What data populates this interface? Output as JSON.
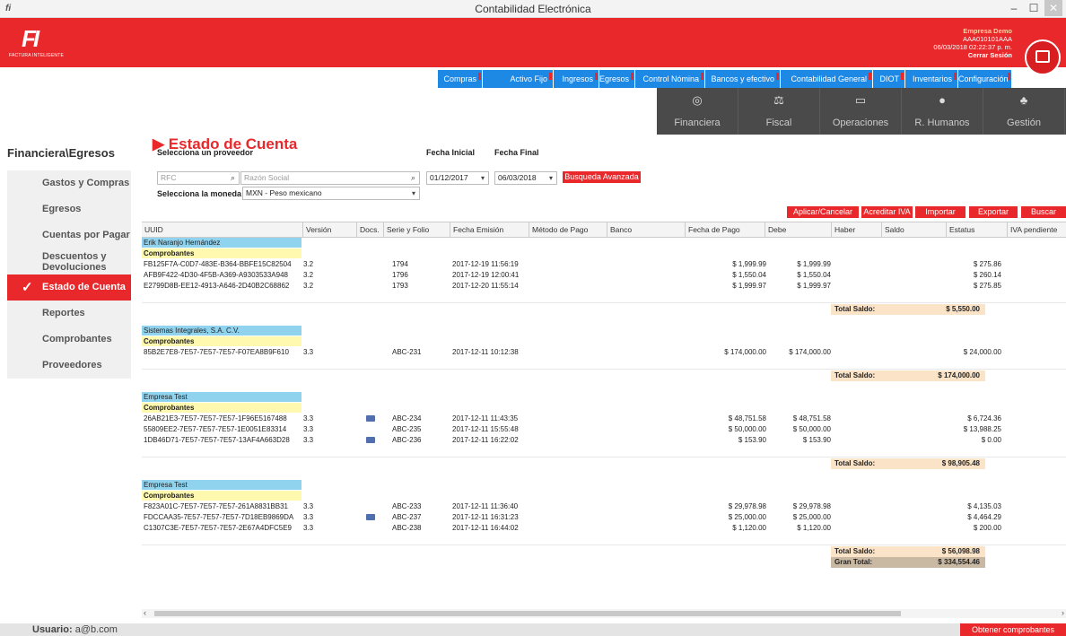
{
  "window": {
    "title": "Contabilidad Electrónica",
    "min": "–",
    "max": "☐",
    "close": "✕"
  },
  "header": {
    "logo_text": "FACTURA INTELIGENTE",
    "company_name": "Empresa Demo",
    "rfc": "AAA010101AAA",
    "datetime": "06/03/2018 02:22:37 p. m.",
    "logout": "Cerrar Sesión"
  },
  "menu": [
    "Compras",
    "Activo Fijo",
    "Ingresos",
    "Egresos",
    "Control Nómina",
    "Bancos y efectivo",
    "Contabilidad General",
    "DIOT",
    "Inventarios",
    "Configuración"
  ],
  "modules": [
    {
      "label": "Financiera",
      "icon": "coins-icon"
    },
    {
      "label": "Fiscal",
      "icon": "scale-icon"
    },
    {
      "label": "Operaciones",
      "icon": "monitor-icon"
    },
    {
      "label": "R. Humanos",
      "icon": "person-icon"
    },
    {
      "label": "Gestión",
      "icon": "org-chart-icon"
    }
  ],
  "breadcrumb": "Financiera\\Egresos",
  "sidebar": [
    {
      "label": "Gastos y Compras"
    },
    {
      "label": "Egresos"
    },
    {
      "label": "Cuentas por Pagar"
    },
    {
      "label": "Descuentos y Devoluciones"
    },
    {
      "label": "Estado de Cuenta",
      "active": true
    },
    {
      "label": "Reportes"
    },
    {
      "label": "Comprobantes"
    },
    {
      "label": "Proveedores"
    }
  ],
  "page_title": "Estado de Cuenta",
  "filters": {
    "provider_label": "Selecciona un proveedor",
    "rfc_placeholder": "RFC",
    "razon_placeholder": "Razón Social",
    "fecha_inicial_label": "Fecha Inicial",
    "fecha_inicial": "01/12/2017",
    "fecha_final_label": "Fecha Final",
    "fecha_final": "06/03/2018",
    "busqueda": "Busqueda Avanzada",
    "moneda_label": "Selecciona la moneda",
    "moneda": "MXN - Peso mexicano"
  },
  "actions": [
    "Aplicar/Cancelar",
    "Acreditar IVA",
    "Importar",
    "Exportar",
    "Buscar"
  ],
  "columns": [
    "UUID",
    "Versión",
    "Docs.",
    "Serie y Folio",
    "Fecha Emisión",
    "Método de Pago",
    "Banco",
    "Fecha de Pago",
    "Debe",
    "Haber",
    "Saldo",
    "Estatus",
    "IVA pendiente"
  ],
  "groups": [
    {
      "provider": "Erik Naranjo Hernández",
      "sub": "Comprobantes",
      "rows": [
        {
          "uuid": "FB125F7A-C0D7-483E-B364-BBFE15C82504",
          "version": "3.2",
          "doc": false,
          "folio": "1794",
          "fecha": "2017-12-19 11:56:19",
          "debe": "$ 1,999.99",
          "haber": "$ 1,999.99",
          "iva": "$ 275.86"
        },
        {
          "uuid": "AFB9F422-4D30-4F5B-A369-A9303533A948",
          "version": "3.2",
          "doc": false,
          "folio": "1796",
          "fecha": "2017-12-19 12:00:41",
          "debe": "$ 1,550.04",
          "haber": "$ 1,550.04",
          "iva": "$ 260.14"
        },
        {
          "uuid": "E2799D8B-EE12-4913-A646-2D40B2C68862",
          "version": "3.2",
          "doc": false,
          "folio": "1793",
          "fecha": "2017-12-20 11:55:14",
          "debe": "$ 1,999.97",
          "haber": "$ 1,999.97",
          "iva": "$ 275.85"
        }
      ],
      "total_label": "Total Saldo:",
      "total": "$ 5,550.00"
    },
    {
      "provider": "Sistemas Integrales, S.A. C.V.",
      "sub": "Comprobantes",
      "rows": [
        {
          "uuid": "85B2E7E8-7E57-7E57-7E57-F07EA8B9F610",
          "version": "3.3",
          "doc": false,
          "folio": "ABC-231",
          "fecha": "2017-12-11 10:12:38",
          "debe": "$ 174,000.00",
          "haber": "$ 174,000.00",
          "iva": "$ 24,000.00"
        }
      ],
      "total_label": "Total Saldo:",
      "total": "$ 174,000.00"
    },
    {
      "provider": "Empresa Test",
      "sub": "Comprobantes",
      "rows": [
        {
          "uuid": "26AB21E3-7E57-7E57-7E57-1F96E5167488",
          "version": "3.3",
          "doc": true,
          "folio": "ABC-234",
          "fecha": "2017-12-11 11:43:35",
          "debe": "$ 48,751.58",
          "haber": "$ 48,751.58",
          "iva": "$ 6,724.36"
        },
        {
          "uuid": "55809EE2-7E57-7E57-7E57-1E0051E83314",
          "version": "3.3",
          "doc": false,
          "folio": "ABC-235",
          "fecha": "2017-12-11 15:55:48",
          "debe": "$ 50,000.00",
          "haber": "$ 50,000.00",
          "iva": "$ 13,988.25"
        },
        {
          "uuid": "1DB46D71-7E57-7E57-7E57-13AF4A663D28",
          "version": "3.3",
          "doc": true,
          "folio": "ABC-236",
          "fecha": "2017-12-11 16:22:02",
          "debe": "$ 153.90",
          "haber": "$ 153.90",
          "iva": "$ 0.00"
        }
      ],
      "total_label": "Total Saldo:",
      "total": "$ 98,905.48"
    },
    {
      "provider": "Empresa Test",
      "sub": "Comprobantes",
      "rows": [
        {
          "uuid": "F823A01C-7E57-7E57-7E57-261A8831BB31",
          "version": "3.3",
          "doc": false,
          "folio": "ABC-233",
          "fecha": "2017-12-11 11:36:40",
          "debe": "$ 29,978.98",
          "haber": "$ 29,978.98",
          "iva": "$ 4,135.03"
        },
        {
          "uuid": "FDCCAA35-7E57-7E57-7E57-7D18EB9869DA",
          "version": "3.3",
          "doc": true,
          "folio": "ABC-237",
          "fecha": "2017-12-11 16:31:23",
          "debe": "$ 25,000.00",
          "haber": "$ 25,000.00",
          "iva": "$ 4,464.29"
        },
        {
          "uuid": "C1307C3E-7E57-7E57-7E57-2E67A4DFC5E9",
          "version": "3.3",
          "doc": false,
          "folio": "ABC-238",
          "fecha": "2017-12-11 16:44:02",
          "debe": "$ 1,120.00",
          "haber": "$ 1,120.00",
          "iva": "$ 200.00"
        }
      ],
      "total_label": "Total Saldo:",
      "total": "$ 56,098.98"
    }
  ],
  "gran_total_label": "Gran Total:",
  "gran_total": "$ 334,554.46",
  "status": {
    "user_label": "Usuario:",
    "user": "a@b.com",
    "obtener": "Obtener comprobantes"
  },
  "colors": {
    "brand_red": "#e8282b",
    "menu_blue": "#1e88e5",
    "group_blue": "#8fd3ef",
    "sub_yellow": "#fff9b0",
    "total_peach": "#fbe3c7"
  }
}
